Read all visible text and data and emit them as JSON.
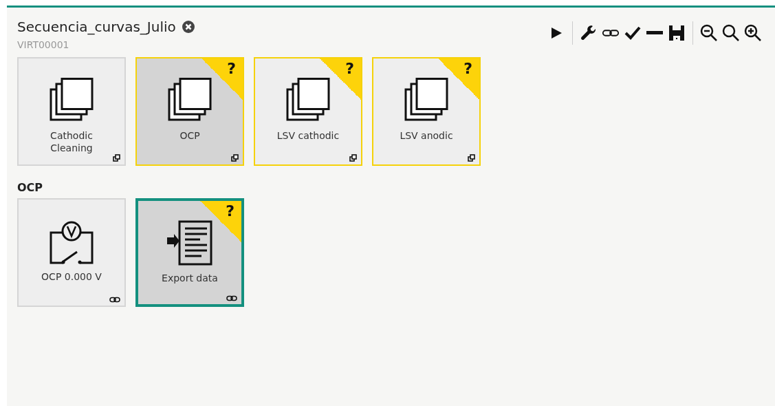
{
  "header": {
    "title": "Secuencia_curvas_Julio",
    "subtitle": "VIRT00001"
  },
  "toolbar": [
    {
      "kind": "play"
    },
    {
      "kind": "sep"
    },
    {
      "kind": "wrench"
    },
    {
      "kind": "link"
    },
    {
      "kind": "check"
    },
    {
      "kind": "minus"
    },
    {
      "kind": "save"
    },
    {
      "kind": "sep"
    },
    {
      "kind": "zoom-out"
    },
    {
      "kind": "zoom"
    },
    {
      "kind": "zoom-in"
    }
  ],
  "groups": [
    {
      "tiles": [
        {
          "label": "Cathodic Cleaning",
          "kind": "sequence",
          "linked": false,
          "active": false,
          "selected": false,
          "warning": false
        },
        {
          "label": "OCP",
          "kind": "sequence",
          "linked": false,
          "active": true,
          "selected": false,
          "warning": true,
          "badge": "?"
        },
        {
          "label": "LSV cathodic",
          "kind": "sequence",
          "linked": false,
          "active": false,
          "selected": false,
          "warning": true,
          "badge": "?"
        },
        {
          "label": "LSV anodic",
          "kind": "sequence",
          "linked": false,
          "active": false,
          "selected": false,
          "warning": true,
          "badge": "?"
        }
      ]
    },
    {
      "heading": "OCP",
      "tiles": [
        {
          "label": "OCP 0.000 V",
          "kind": "voltmeter",
          "linked": true,
          "active": false,
          "selected": false,
          "warning": false
        },
        {
          "label": "Export data",
          "kind": "export",
          "linked": true,
          "active": true,
          "selected": true,
          "warning": true,
          "badge": "?"
        }
      ]
    }
  ]
}
